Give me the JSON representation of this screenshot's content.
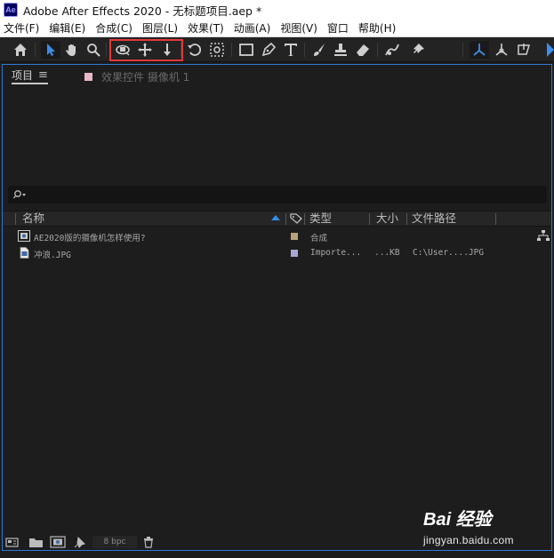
{
  "window": {
    "app_icon_text": "Ae",
    "title": "Adobe After Effects 2020 - 无标题项目.aep *"
  },
  "menu": [
    "文件(F)",
    "编辑(E)",
    "合成(C)",
    "图层(L)",
    "效果(T)",
    "动画(A)",
    "视图(V)",
    "窗口",
    "帮助(H)"
  ],
  "toolbar": {
    "tools": [
      "home-icon",
      "selection-tool-icon",
      "hand-tool-icon",
      "zoom-tool-icon",
      "orbit-camera-tool-icon",
      "pan-camera-tool-icon",
      "dolly-camera-tool-icon",
      "rotation-tool-icon",
      "pan-behind-tool-icon",
      "rectangle-tool-icon",
      "pen-tool-icon",
      "type-tool-icon",
      "brush-tool-icon",
      "clone-stamp-tool-icon",
      "eraser-tool-icon",
      "roto-brush-tool-icon",
      "puppet-pin-tool-icon",
      "local-axis-icon",
      "world-axis-icon",
      "view-axis-icon"
    ],
    "highlight_color": "#e23a3a"
  },
  "panel": {
    "tab_project": "项目",
    "tab_effects": "效果控件 摄像机 1",
    "search_placeholder": "",
    "columns": {
      "name": "名称",
      "type": "类型",
      "size": "大小",
      "path": "文件路径"
    },
    "rows": [
      {
        "name": "AE2020版的摄像机怎样使用?",
        "label_color": "#b8a37c",
        "type": "合成",
        "size": "",
        "path": "",
        "icon": "composition-icon"
      },
      {
        "name": "冲浪.JPG",
        "label_color": "#a6a6d6",
        "type": "Importe...",
        "size": "...KB",
        "path": "C:\\User....JPG",
        "icon": "image-file-icon"
      }
    ],
    "bpc": "8 bpc"
  },
  "watermark": {
    "logo": "Bai 经验",
    "url": "jingyan.baidu.com"
  },
  "colors": {
    "accent": "#2e7ad6",
    "panel_bg": "#1d1d1d"
  }
}
